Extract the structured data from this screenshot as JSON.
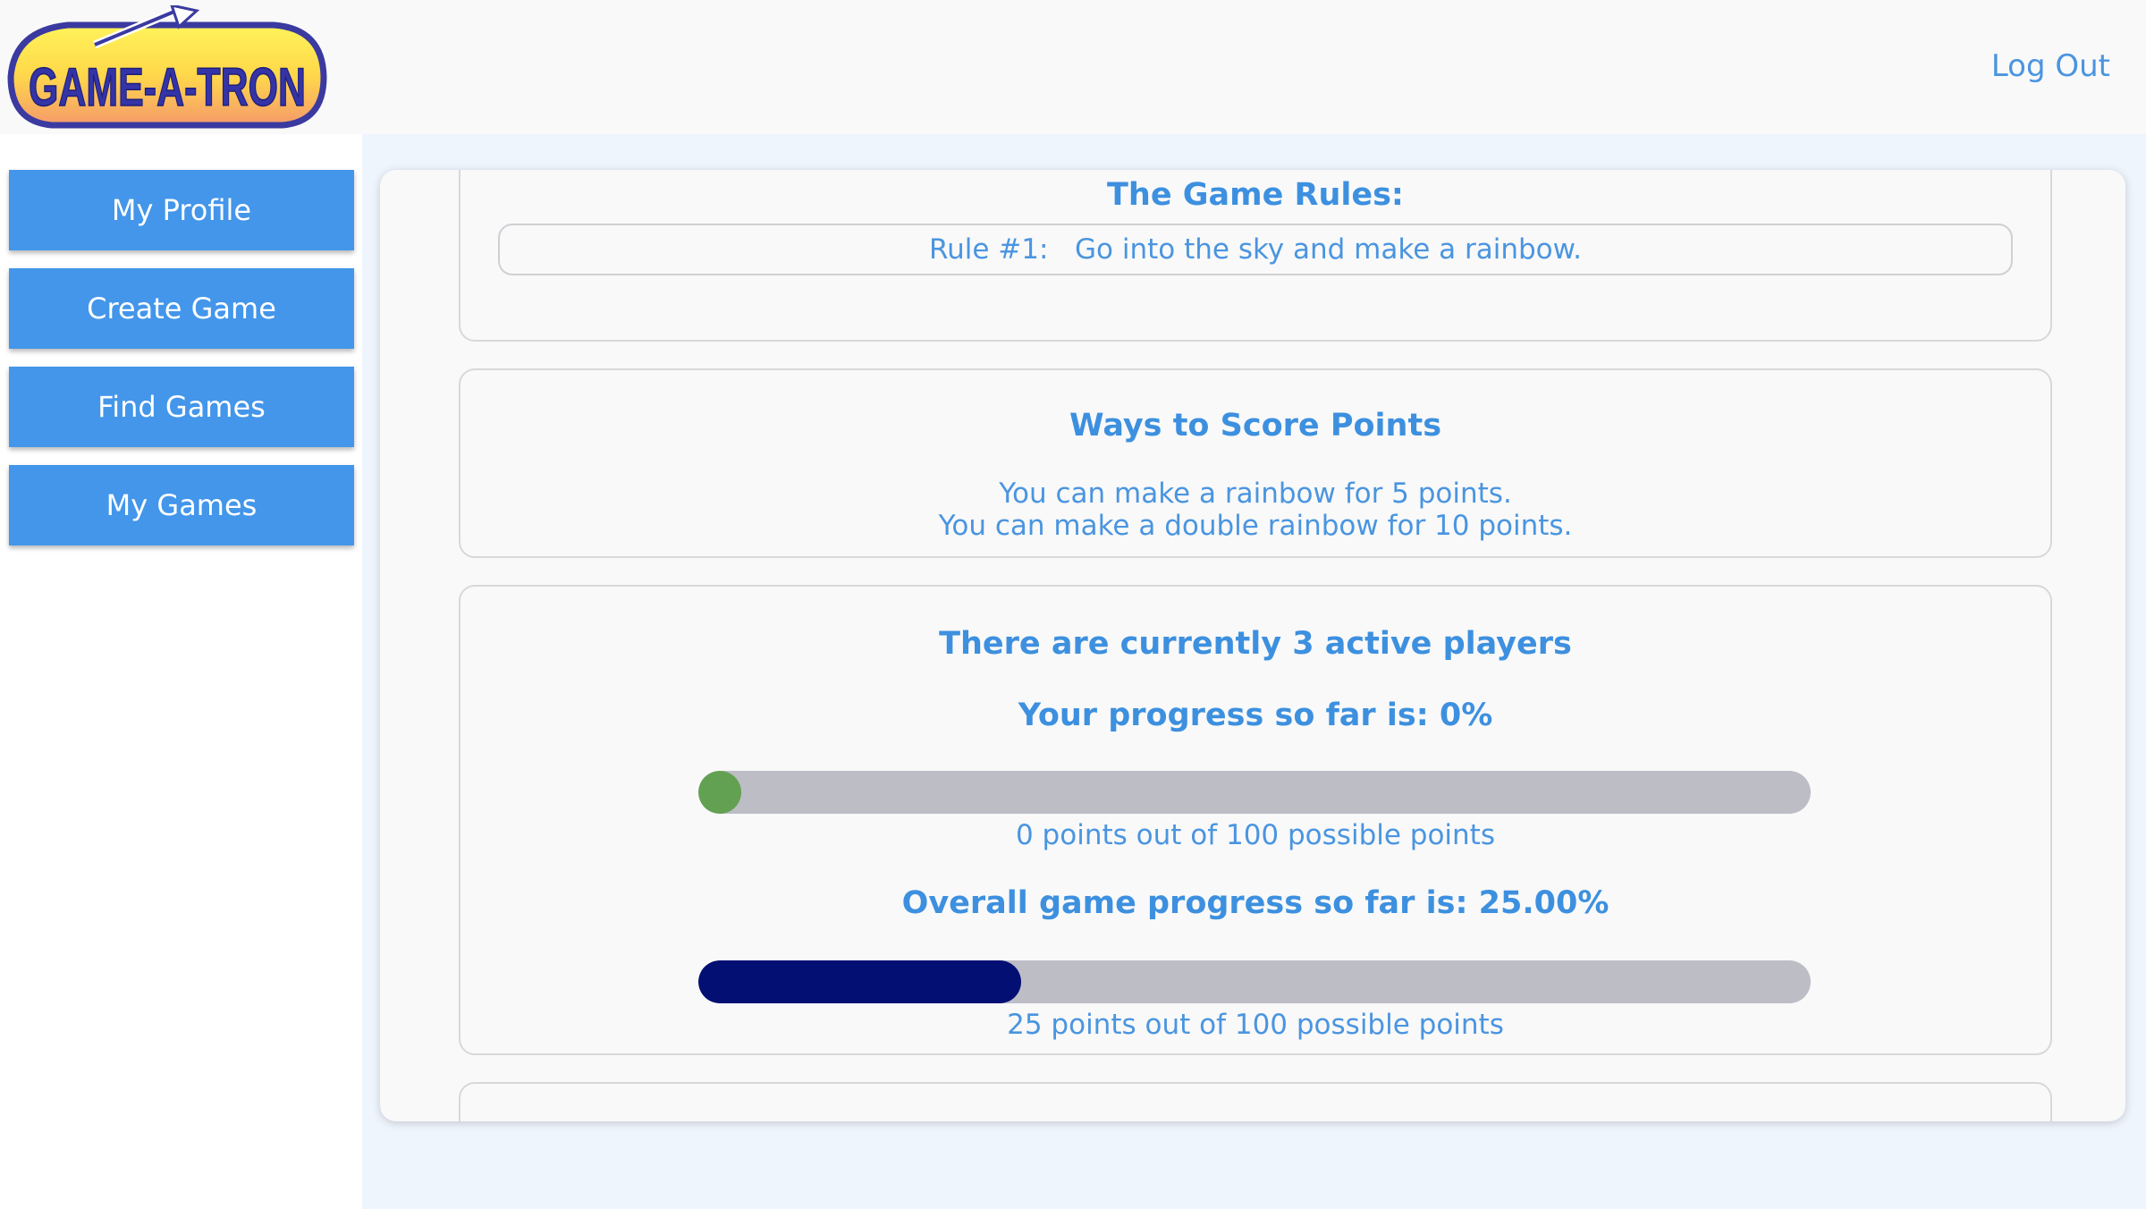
{
  "header": {
    "logo_text": "GAME-A-TRON",
    "logout_label": "Log Out"
  },
  "sidebar": {
    "items": [
      {
        "label": "My Profile"
      },
      {
        "label": "Create Game"
      },
      {
        "label": "Find Games"
      },
      {
        "label": "My Games"
      }
    ]
  },
  "rules": {
    "title": "The Game Rules:",
    "items": [
      "Rule #1:   Go into the sky and make a rainbow."
    ]
  },
  "scoring": {
    "title": "Ways to Score Points",
    "lines": [
      "You can make a rainbow for 5 points.",
      "You can make a double rainbow for 10 points."
    ]
  },
  "progress": {
    "active_players_text": "There are currently 3 active players",
    "your_progress_title": "Your progress so far is: 0%",
    "your_progress_fraction": 0,
    "your_points_text": "0 points out of 100 possible points",
    "overall_progress_title": "Overall game progress so far is: 25.00%",
    "overall_progress_fraction": 0.25,
    "overall_points_text": "25 points out of 100 possible points"
  },
  "colors": {
    "accent": "#4396ea",
    "text": "#4a95e0",
    "your_progress_fill": "#62a152",
    "overall_progress_fill": "#040f74",
    "track": "#bdbdc6"
  }
}
